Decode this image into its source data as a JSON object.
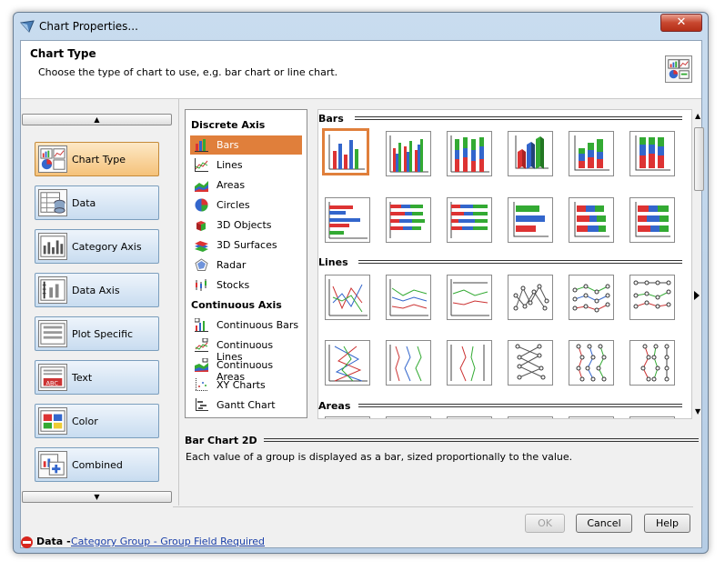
{
  "window": {
    "title": "Chart Properties..."
  },
  "header": {
    "title": "Chart Type",
    "description": "Choose the type of chart to use, e.g. bar chart or line chart."
  },
  "sidebar": {
    "items": [
      {
        "label": "Chart Type",
        "active": true,
        "icon": "chart-type-icon"
      },
      {
        "label": "Data",
        "icon": "data-icon"
      },
      {
        "label": "Category Axis",
        "icon": "category-axis-icon"
      },
      {
        "label": "Data Axis",
        "icon": "data-axis-icon"
      },
      {
        "label": "Plot Specific",
        "icon": "plot-specific-icon"
      },
      {
        "label": "Text",
        "icon": "text-icon"
      },
      {
        "label": "Color",
        "icon": "color-icon"
      },
      {
        "label": "Combined",
        "icon": "combined-icon"
      }
    ]
  },
  "chart_list": {
    "discrete_heading": "Discrete Axis",
    "discrete": [
      {
        "label": "Bars",
        "selected": true,
        "icon": "bars-icon"
      },
      {
        "label": "Lines",
        "icon": "lines-icon"
      },
      {
        "label": "Areas",
        "icon": "areas-icon"
      },
      {
        "label": "Circles",
        "icon": "circles-icon"
      },
      {
        "label": "3D Objects",
        "icon": "3d-objects-icon"
      },
      {
        "label": "3D Surfaces",
        "icon": "3d-surfaces-icon"
      },
      {
        "label": "Radar",
        "icon": "radar-icon"
      },
      {
        "label": "Stocks",
        "icon": "stocks-icon"
      }
    ],
    "continuous_heading": "Continuous Axis",
    "continuous": [
      {
        "label": "Continuous Bars",
        "icon": "continuous-bars-icon"
      },
      {
        "label": "Continuous Lines",
        "icon": "continuous-lines-icon"
      },
      {
        "label": "Continuous Areas",
        "icon": "continuous-areas-icon"
      },
      {
        "label": "XY Charts",
        "icon": "xy-charts-icon"
      },
      {
        "label": "Gantt Chart",
        "icon": "gantt-chart-icon"
      }
    ]
  },
  "gallery": {
    "sections": [
      "Bars",
      "Lines",
      "Areas"
    ]
  },
  "description": {
    "title": "Bar Chart 2D",
    "text": "Each value of a group is displayed as a bar, sized proportionally to the value."
  },
  "buttons": {
    "ok": "OK",
    "cancel": "Cancel",
    "help": "Help"
  },
  "status": {
    "label": "Data",
    "separator": " - ",
    "link": "Category Group - Group Field Required"
  },
  "colors": {
    "accent": "#e07f3b",
    "error": "#d7261e",
    "link": "#1a3fa8"
  }
}
